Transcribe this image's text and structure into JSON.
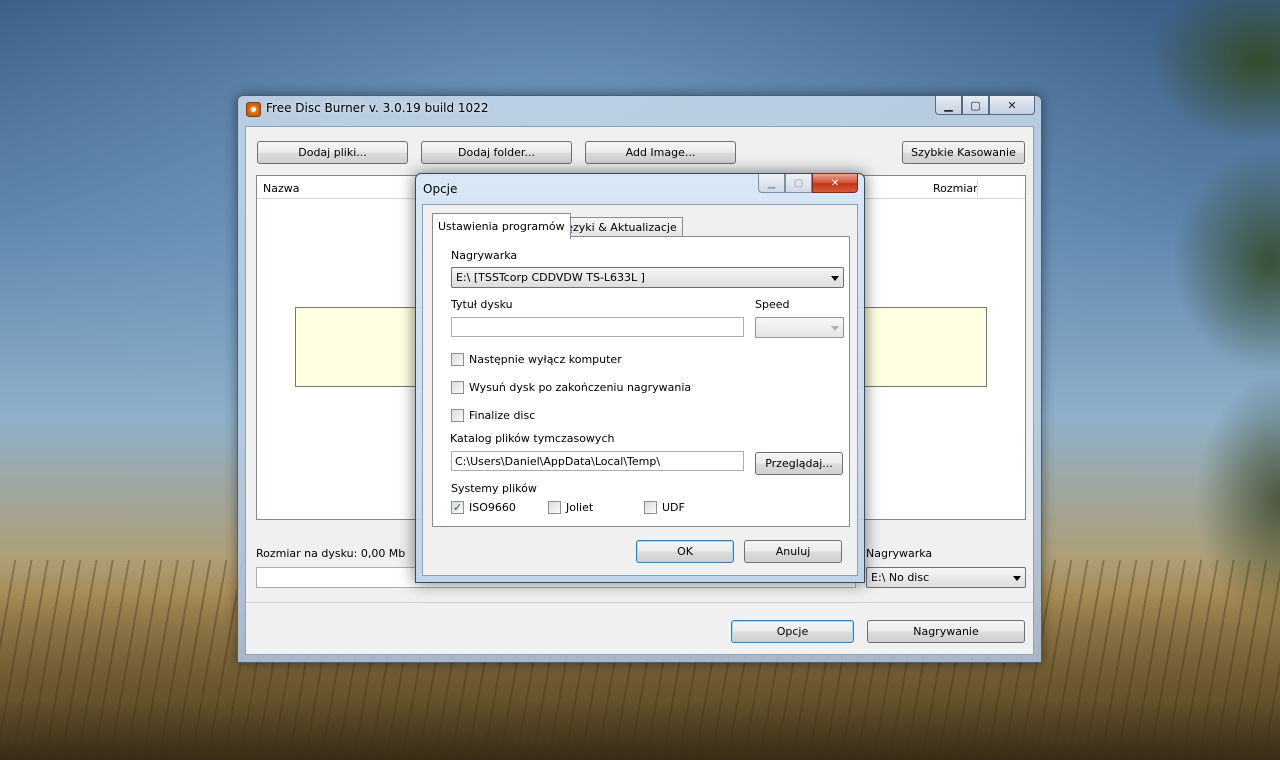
{
  "main_window": {
    "title": "Free Disc Burner   v. 3.0.19 build 1022",
    "buttons": {
      "add_files": "Dodaj pliki...",
      "add_folder": "Dodaj folder...",
      "add_image": "Add Image...",
      "quick_erase": "Szybkie Kasowanie",
      "options": "Opcje",
      "burn": "Nagrywanie"
    },
    "list_columns": {
      "name": "Nazwa",
      "size": "Rozmiar"
    },
    "disk_size_label": "Rozmiar na dysku: 0,00 Mb",
    "disk_usage_fraction": 0,
    "burner_label": "Nagrywarka",
    "burner_value": "E:\\ No disc"
  },
  "dialog": {
    "title": "Opcje",
    "tabs": [
      "Ustawienia programów",
      "Języki & Aktualizacje"
    ],
    "burner_label": "Nagrywarka",
    "burner_value": "E:\\ [TSSTcorp CDDVDW TS-L633L ]",
    "disc_title_label": "Tytuł dysku",
    "disc_title_value": "",
    "speed_label": "Speed",
    "speed_value": "",
    "checkboxes": [
      {
        "label": "Następnie wyłącz komputer",
        "checked": false
      },
      {
        "label": "Wysuń dysk po zakończeniu nagrywania",
        "checked": false
      },
      {
        "label": "Finalize disc",
        "checked": false
      }
    ],
    "temp_dir_label": "Katalog plików tymczasowych",
    "temp_dir_value": "C:\\Users\\Daniel\\AppData\\Local\\Temp\\",
    "browse_button": "Przeglądaj...",
    "filesystems_label": "Systemy plików",
    "filesystems": [
      {
        "label": "ISO9660",
        "checked": true
      },
      {
        "label": "Joliet",
        "checked": false
      },
      {
        "label": "UDF",
        "checked": false
      }
    ],
    "ok_button": "OK",
    "cancel_button": "Anuluj"
  }
}
